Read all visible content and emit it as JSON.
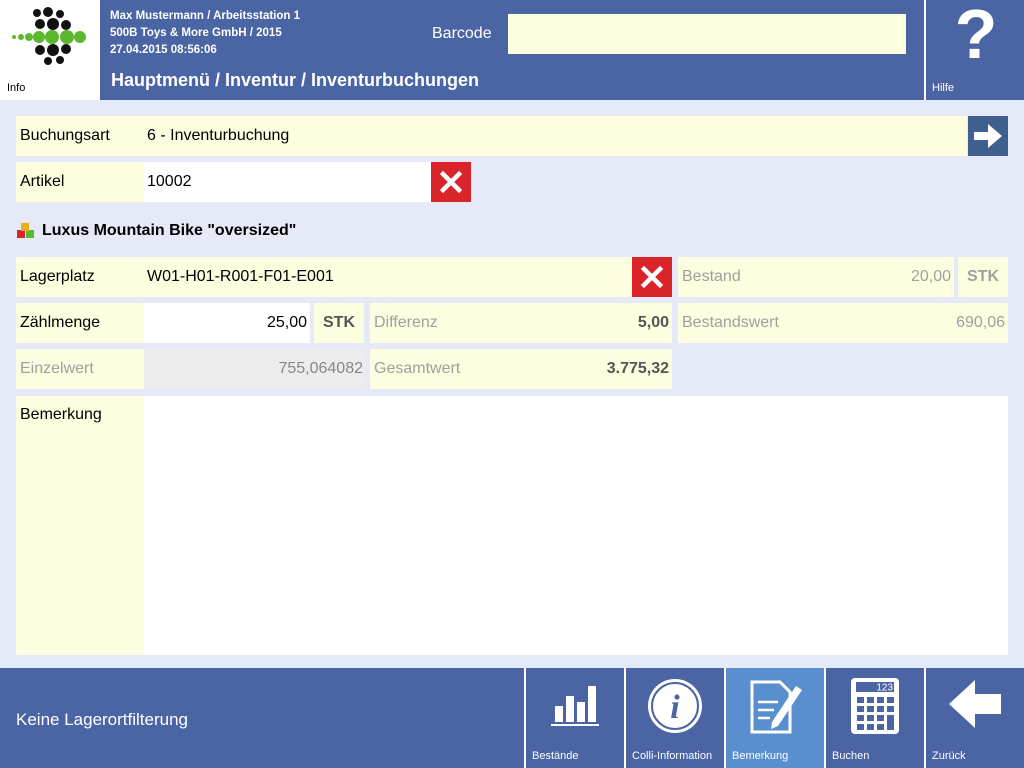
{
  "header": {
    "info_label": "Info",
    "user_line": "Max Mustermann / Arbeitsstation 1",
    "company_line": "500B Toys & More GmbH / 2015",
    "datetime": "27.04.2015 08:56:06",
    "breadcrumb": "Hauptmenü / Inventur / Inventurbuchungen",
    "barcode_label": "Barcode",
    "barcode_value": "",
    "help_symbol": "?",
    "help_label": "Hilfe"
  },
  "form": {
    "buchungsart": {
      "label": "Buchungsart",
      "value": "6 - Inventurbuchung"
    },
    "artikel": {
      "label": "Artikel",
      "value": "10002"
    },
    "article_name": "Luxus Mountain Bike \"oversized\"",
    "lagerplatz": {
      "label": "Lagerplatz",
      "value": "W01-H01-R001-F01-E001"
    },
    "bestand": {
      "label": "Bestand",
      "value": "20,00",
      "unit": "STK"
    },
    "zaehlmenge": {
      "label": "Zählmenge",
      "value": "25,00",
      "unit": "STK"
    },
    "differenz": {
      "label": "Differenz",
      "value": "5,00"
    },
    "bestandswert": {
      "label": "Bestandswert",
      "value": "690,06"
    },
    "einzelwert": {
      "label": "Einzelwert",
      "value": "755,064082"
    },
    "gesamtwert": {
      "label": "Gesamtwert",
      "value": "3.775,32"
    },
    "bemerkung": {
      "label": "Bemerkung",
      "value": ""
    }
  },
  "footer": {
    "status": "Keine Lagerortfilterung",
    "buttons": [
      {
        "label": "Bestände",
        "icon": "bar-chart-icon"
      },
      {
        "label": "Colli-Information",
        "icon": "info-circle-icon"
      },
      {
        "label": "Bemerkung",
        "icon": "document-edit-icon"
      },
      {
        "label": "Buchen",
        "icon": "calculator-icon",
        "display": "123"
      },
      {
        "label": "Zurück",
        "icon": "arrow-left-icon"
      }
    ]
  },
  "colors": {
    "header_bg": "#4a64a4",
    "page_bg": "#e6e9f7",
    "field_yellow": "#fdfde0",
    "delete_red": "#d9252a",
    "active_button": "#5a8fcf"
  }
}
